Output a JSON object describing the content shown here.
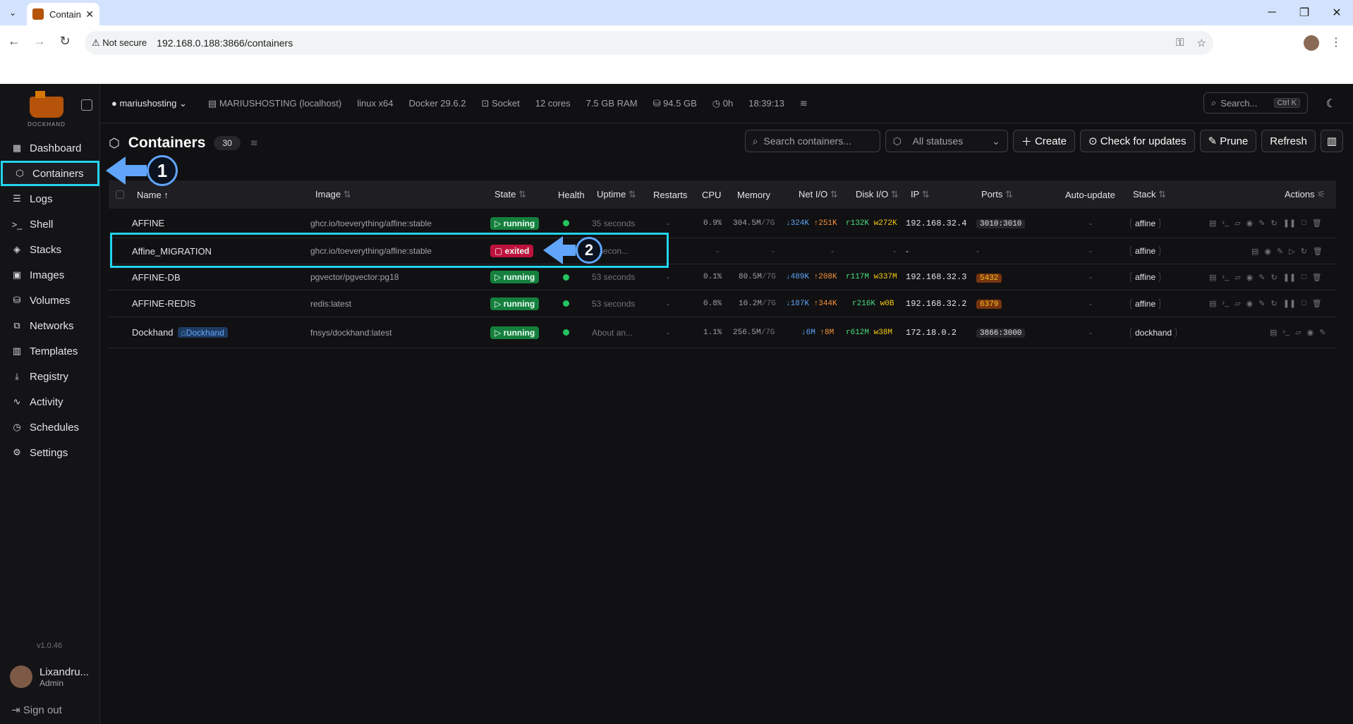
{
  "browser": {
    "tab_title": "Contain",
    "not_secure": "Not secure",
    "url": "192.168.0.188:3866/containers"
  },
  "sidebar": {
    "logo_text": "DOCKHAND",
    "items": [
      {
        "label": "Dashboard",
        "icon": "dashboard-icon"
      },
      {
        "label": "Containers",
        "icon": "box-icon"
      },
      {
        "label": "Logs",
        "icon": "logs-icon"
      },
      {
        "label": "Shell",
        "icon": "terminal-icon"
      },
      {
        "label": "Stacks",
        "icon": "layers-icon"
      },
      {
        "label": "Images",
        "icon": "image-icon"
      },
      {
        "label": "Volumes",
        "icon": "database-icon"
      },
      {
        "label": "Networks",
        "icon": "network-icon"
      },
      {
        "label": "Templates",
        "icon": "library-icon"
      },
      {
        "label": "Registry",
        "icon": "download-icon"
      },
      {
        "label": "Activity",
        "icon": "activity-icon"
      },
      {
        "label": "Schedules",
        "icon": "clock-icon"
      },
      {
        "label": "Settings",
        "icon": "gear-icon"
      }
    ],
    "version": "v1.0.46",
    "user_name": "Lixandru...",
    "user_role": "Admin",
    "sign_out": "Sign out"
  },
  "topbar": {
    "environment": "mariushosting",
    "host": "MARIUSHOSTING (localhost)",
    "platform": "linux x64",
    "docker": "Docker 29.6.2",
    "connection": "Socket",
    "cores": "12 cores",
    "ram": "7.5 GB RAM",
    "disk": "94.5 GB",
    "uptime": "0h",
    "time": "18:39:13",
    "search_placeholder": "Search...",
    "search_kbd": "Ctrl K"
  },
  "page": {
    "title": "Containers",
    "count": "30",
    "search_placeholder": "Search containers...",
    "status_filter": "All statuses",
    "create": "Create",
    "check_updates": "Check for updates",
    "prune": "Prune",
    "refresh": "Refresh"
  },
  "table": {
    "headers": [
      "Name",
      "Image",
      "State",
      "Health",
      "Uptime",
      "Restarts",
      "CPU",
      "Memory",
      "Net I/O",
      "Disk I/O",
      "IP",
      "Ports",
      "Auto-update",
      "Stack",
      "Actions"
    ],
    "rows": [
      {
        "name": "AFFINE",
        "image": "ghcr.io/toeverything/affine:stable",
        "state": "running",
        "uptime": "35 seconds",
        "restarts": "-",
        "cpu": "0.9%",
        "mem": "304.5M",
        "mem_total": "/7G",
        "net_rx": "↓324K",
        "net_tx": "↑251K",
        "disk_r": "r132K",
        "disk_w": "w272K",
        "ip": "192.168.32.4",
        "port": "3010:3010",
        "auto": "-",
        "stack": "affine"
      },
      {
        "name": "Affine_MIGRATION",
        "image": "ghcr.io/toeverything/affine:stable",
        "state": "exited",
        "uptime": "5 secon...",
        "restarts": "-",
        "cpu": "-",
        "mem": "-",
        "mem_total": "",
        "net_rx": "-",
        "net_tx": "",
        "disk_r": "-",
        "disk_w": "",
        "ip": "-",
        "port": "-",
        "auto": "-",
        "stack": "affine"
      },
      {
        "name": "AFFINE-DB",
        "image": "pgvector/pgvector:pg18",
        "state": "running",
        "uptime": "53 seconds",
        "restarts": "-",
        "cpu": "0.1%",
        "mem": "80.5M",
        "mem_total": "/7G",
        "net_rx": "↓489K",
        "net_tx": "↑208K",
        "disk_r": "r117M",
        "disk_w": "w337M",
        "ip": "192.168.32.3",
        "port": "5432",
        "auto": "-",
        "stack": "affine"
      },
      {
        "name": "AFFINE-REDIS",
        "image": "redis:latest",
        "state": "running",
        "uptime": "53 seconds",
        "restarts": "-",
        "cpu": "0.8%",
        "mem": "10.2M",
        "mem_total": "/7G",
        "net_rx": "↓187K",
        "net_tx": "↑344K",
        "disk_r": "r216K",
        "disk_w": "w0B",
        "ip": "192.168.32.2",
        "port": "6379",
        "auto": "-",
        "stack": "affine"
      },
      {
        "name": "Dockhand",
        "tag": "Dockhand",
        "image": "fnsys/dockhand:latest",
        "state": "running",
        "uptime": "About an...",
        "restarts": "-",
        "cpu": "1.1%",
        "mem": "256.5M",
        "mem_total": "/7G",
        "net_rx": "↓6M",
        "net_tx": "↑8M",
        "disk_r": "r612M",
        "disk_w": "w38M",
        "ip": "172.18.0.2",
        "port": "3866:3000",
        "auto": "-",
        "stack": "dockhand"
      }
    ]
  },
  "annotations": {
    "step1": "1",
    "step2": "2"
  }
}
